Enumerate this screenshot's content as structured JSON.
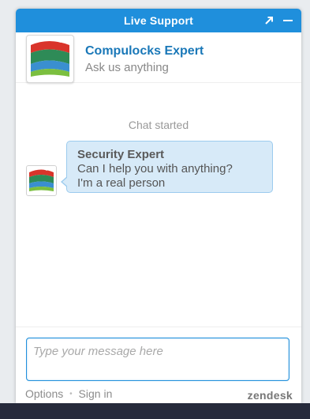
{
  "window": {
    "title": "Live Support",
    "popout_icon": "popout-arrow-icon",
    "minimize_icon": "minimize-icon"
  },
  "header": {
    "agent_name": "Compulocks Expert",
    "tagline": "Ask us anything",
    "logo_icon": "compulocks-logo"
  },
  "chat": {
    "status": "Chat started",
    "messages": [
      {
        "sender": "Security Expert",
        "lines": [
          "Can I help you with anything?",
          "I'm a real person"
        ],
        "avatar_icon": "compulocks-logo"
      }
    ]
  },
  "composer": {
    "placeholder": "Type your message here",
    "value": ""
  },
  "footer": {
    "options_label": "Options",
    "separator": "•",
    "signin_label": "Sign in",
    "brand": "zendesk"
  },
  "colors": {
    "accent": "#1f8fdc",
    "agent_name": "#1a78b8",
    "bubble_bg": "#d7eaf8",
    "bubble_border": "#9ccbee",
    "bottom_bar": "#262a3b"
  }
}
